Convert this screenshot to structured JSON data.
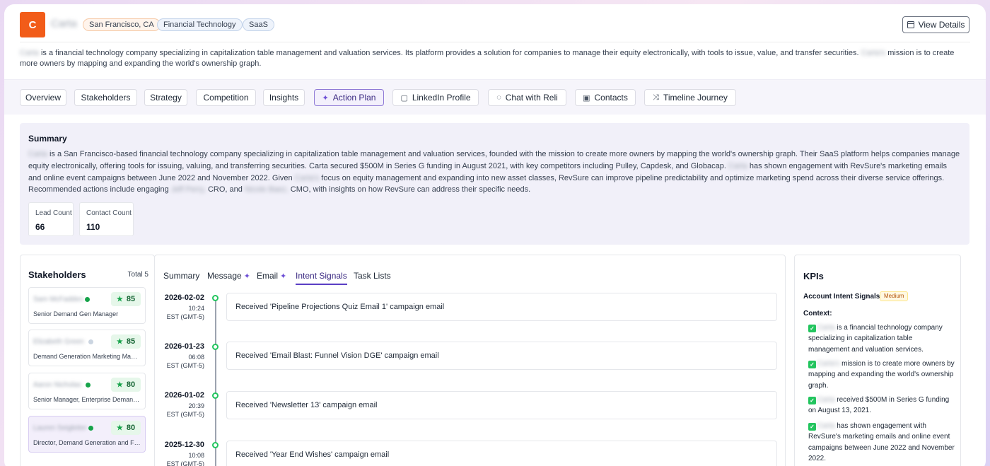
{
  "company": {
    "logo_letter": "C",
    "name": "Carta",
    "tags": [
      "San Francisco, CA",
      "Financial Technology",
      "SaaS"
    ],
    "description_pre": "is a financial technology company specializing in capitalization table management and valuation services. Its platform provides a solution for companies to manage their equity electronically, with tools to issue, value, and transfer securities.",
    "description_mid": "mission is to create more owners by mapping and expanding the world's ownership graph.",
    "view_details_label": "View Details"
  },
  "tabs": [
    {
      "label": "Overview",
      "icon": ""
    },
    {
      "label": "Stakeholders",
      "icon": ""
    },
    {
      "label": "Strategy",
      "icon": ""
    },
    {
      "label": "Competition",
      "icon": ""
    },
    {
      "label": "Insights",
      "icon": ""
    },
    {
      "label": "Action Plan",
      "icon": "sparkle-icon"
    },
    {
      "label": "LinkedIn Profile",
      "icon": "linkedin-icon"
    },
    {
      "label": "Chat with Reli",
      "icon": "chat-icon"
    },
    {
      "label": "Contacts",
      "icon": "contact-icon"
    },
    {
      "label": "Timeline Journey",
      "icon": "shuffle-icon"
    }
  ],
  "summary": {
    "title": "Summary",
    "p1": "is a San Francisco-based financial technology company specializing in capitalization table management and valuation services, founded with the mission to create more owners by mapping the world's ownership graph. Their SaaS platform helps companies manage equity electronically, offering tools for issuing, valuing, and transferring securities. Carta secured $500M in Series G funding in August 2021, with key competitors including Pulley, Capdesk, and Globacap.",
    "p2": "has shown engagement with RevSure's marketing emails and online event campaigns between June 2022 and November 2022. Given",
    "p3": "focus on equity management and expanding into new asset classes, RevSure can improve pipeline predictability and optimize marketing spend across their diverse service offerings. Recommended actions include engaging",
    "p4": "CRO, and",
    "p5": "CMO, with insights on how RevSure can address their specific needs.",
    "blur_carta": "Carta",
    "blur_carta_s": "Carta's",
    "blur_cro": "Jeff Perry,",
    "blur_cmo": "Nicole Baez,",
    "stats": [
      {
        "label": "Lead Count",
        "value": "66"
      },
      {
        "label": "Contact Count",
        "value": "110"
      }
    ]
  },
  "stakeholders": {
    "title": "Stakeholders",
    "total": "Total 5",
    "items": [
      {
        "name": "Sam McFadden",
        "status_color": "#16a34a",
        "score": "85",
        "role": "Senior Demand Gen Manager"
      },
      {
        "name": "Elizabeth Green",
        "status_color": "#cbd5e1",
        "score": "85",
        "role": "Demand Generation Marketing Manag..."
      },
      {
        "name": "Aaron Nicholas",
        "status_color": "#16a34a",
        "score": "80",
        "role": "Senior Manager, Enterprise Demand G..."
      },
      {
        "name": "Lauren Seigleiter",
        "status_color": "#16a34a",
        "score": "80",
        "role": "Director, Demand Generation and Fiel..."
      }
    ]
  },
  "activity": {
    "tabs": [
      {
        "label": "Summary",
        "sparkle": false
      },
      {
        "label": "Message",
        "sparkle": true
      },
      {
        "label": "Email",
        "sparkle": true
      },
      {
        "label": "Intent Signals",
        "sparkle": false
      },
      {
        "label": "Task Lists",
        "sparkle": false
      }
    ],
    "events": [
      {
        "date": "2026-02-02",
        "time": "10:24",
        "tz": "EST (GMT-5)",
        "text": "Received 'Pipeline Projections Quiz Email 1' campaign email"
      },
      {
        "date": "2026-01-23",
        "time": "06:08",
        "tz": "EST (GMT-5)",
        "text": "Received 'Email Blast: Funnel Vision DGE' campaign email"
      },
      {
        "date": "2026-01-02",
        "time": "20:39",
        "tz": "EST (GMT-5)",
        "text": "Received 'Newsletter 13' campaign email"
      },
      {
        "date": "2025-12-30",
        "time": "10:08",
        "tz": "EST (GMT-5)",
        "text": "Received 'Year End Wishes' campaign email"
      }
    ]
  },
  "kpis": {
    "title": "KPIs",
    "signal_label": "Account Intent Signals",
    "signal_level": "Medium",
    "context_label": "Context:",
    "blur_carta": "Carta",
    "blur_carta_s": "Carta's",
    "items": [
      "is a financial technology company specializing in capitalization table management and valuation services.",
      "mission is to create more owners by mapping and expanding the world's ownership graph.",
      "received $500M in Series G funding on August 13, 2021.",
      "has shown engagement with RevSure's marketing emails and online event campaigns between June 2022 and November 2022."
    ]
  },
  "colors": {
    "accent": "#5b3fc4",
    "logo": "#f25c19",
    "success": "#22c55e"
  }
}
